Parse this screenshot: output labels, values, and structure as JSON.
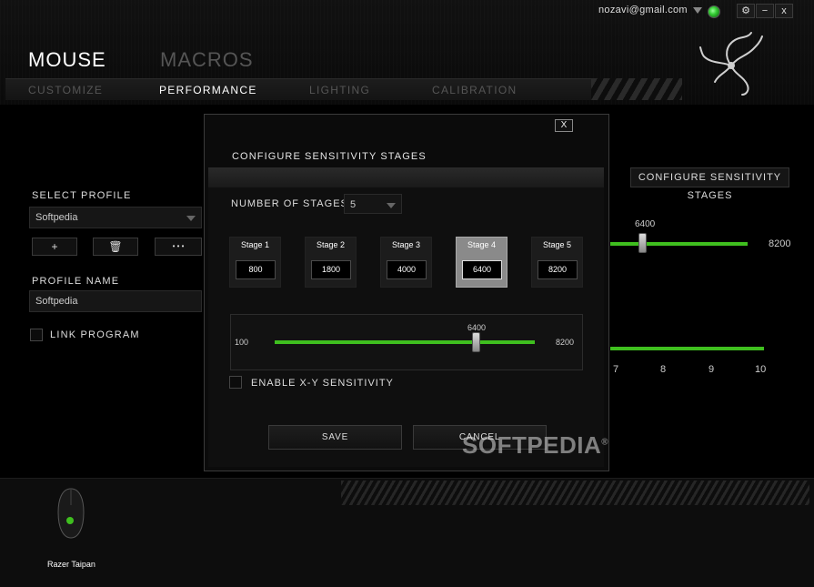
{
  "account": {
    "email": "nozavi@gmail.com"
  },
  "window_controls": {
    "settings": "⚙",
    "minimize": "−",
    "close": "x"
  },
  "main_tabs": [
    {
      "label": "MOUSE"
    },
    {
      "label": "MACROS"
    }
  ],
  "sub_tabs": [
    {
      "label": "CUSTOMIZE"
    },
    {
      "label": "PERFORMANCE"
    },
    {
      "label": "LIGHTING"
    },
    {
      "label": "CALIBRATION"
    }
  ],
  "sidebar": {
    "select_profile_label": "SELECT PROFILE",
    "profile_value": "Softpedia",
    "add_label": "+",
    "delete_label": "🗑",
    "more_label": "• • •",
    "profile_name_label": "PROFILE NAME",
    "profile_name_value": "Softpedia",
    "link_program_label": "LINK PROGRAM"
  },
  "background": {
    "configure_button": "CONFIGURE SENSITIVITY STAGES",
    "slider_current": "6400",
    "slider_max": "8200",
    "ticks": [
      "7",
      "8",
      "9",
      "10"
    ]
  },
  "modal": {
    "close_label": "X",
    "title": "CONFIGURE SENSITIVITY STAGES",
    "number_of_stages_label": "NUMBER OF STAGES",
    "number_of_stages_value": "5",
    "stages": [
      {
        "name": "Stage 1",
        "value": "800"
      },
      {
        "name": "Stage 2",
        "value": "1800"
      },
      {
        "name": "Stage 3",
        "value": "4000"
      },
      {
        "name": "Stage 4",
        "value": "6400"
      },
      {
        "name": "Stage 5",
        "value": "8200"
      }
    ],
    "slider": {
      "min": "100",
      "max": "8200",
      "current": "6400"
    },
    "enable_xy_label": "ENABLE X-Y SENSITIVITY",
    "save_label": "SAVE",
    "cancel_label": "CANCEL"
  },
  "device": {
    "name": "Razer Taipan"
  },
  "watermark": {
    "text": "SOFTPEDIA",
    "mark": "®"
  },
  "colors": {
    "accent": "#3fbf1f"
  }
}
